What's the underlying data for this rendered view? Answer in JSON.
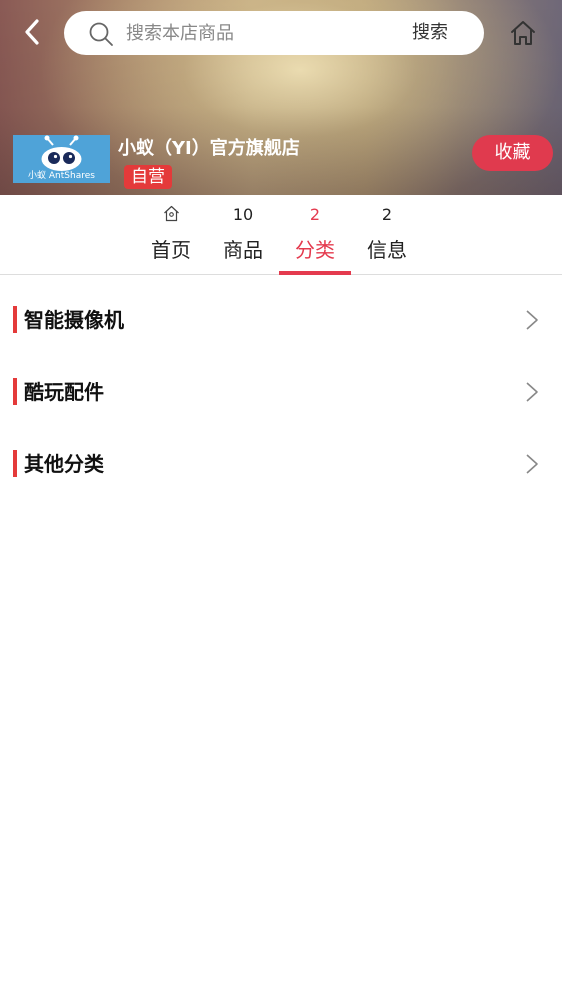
{
  "header": {
    "search_placeholder": "搜索本店商品",
    "search_button": "搜索"
  },
  "store": {
    "name": "小蚁（YI）官方旗舰店",
    "badge": "自营",
    "logo_text": "小蚁 AntShares",
    "favorite_button": "收藏"
  },
  "tabs": [
    {
      "label": "首页",
      "icon": "home-icon"
    },
    {
      "label": "商品",
      "count": "10"
    },
    {
      "label": "分类",
      "count": "2",
      "active": true
    },
    {
      "label": "信息",
      "count": "2"
    }
  ],
  "categories": [
    {
      "label": "智能摄像机"
    },
    {
      "label": "酷玩配件"
    },
    {
      "label": "其他分类"
    }
  ],
  "colors": {
    "accent": "#e43a4e",
    "badge": "#e43a3a",
    "logo_bg": "#4fa3d8"
  }
}
